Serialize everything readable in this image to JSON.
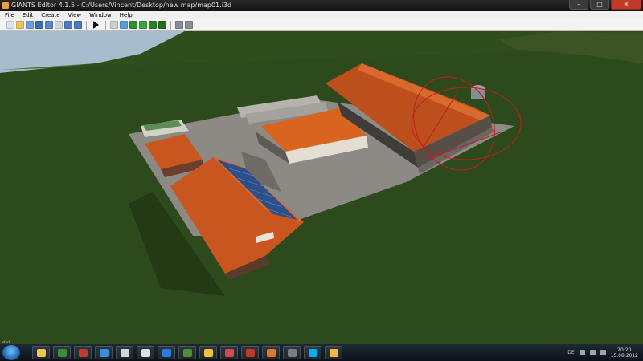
{
  "window": {
    "title": "GIANTS Editor 4.1.5 - C:/Users/Vincent/Desktop/new map/map01.i3d",
    "minimize": "–",
    "maximize": "□",
    "close": "✕"
  },
  "menu": [
    "File",
    "Edit",
    "Create",
    "View",
    "Window",
    "Help"
  ],
  "toolbar": {
    "icons": [
      {
        "name": "new-icon",
        "color": "#d9e3ef"
      },
      {
        "name": "open-icon",
        "color": "#e8c35a"
      },
      {
        "name": "import-icon",
        "color": "#6f9fd8"
      },
      {
        "name": "save-icon",
        "color": "#3b6fb5"
      },
      {
        "name": "save-as-icon",
        "color": "#5a88c6"
      },
      {
        "name": "reload-icon",
        "color": "#cfd6e0"
      },
      {
        "name": "undo-icon",
        "color": "#4b7ac0"
      },
      {
        "name": "redo-icon",
        "color": "#4b7ac0"
      },
      {
        "name": "sep"
      },
      {
        "name": "play-icon",
        "color": "#111111"
      },
      {
        "name": "sep"
      },
      {
        "name": "select-icon",
        "color": "#cfcfcf"
      },
      {
        "name": "move-icon",
        "color": "#5a9bd8"
      },
      {
        "name": "terrain-raise-icon",
        "color": "#2f8f2f"
      },
      {
        "name": "terrain-paint-icon",
        "color": "#3aa53a"
      },
      {
        "name": "terrain-smooth-icon",
        "color": "#2b7d2b"
      },
      {
        "name": "foliage-icon",
        "color": "#1f6f1f"
      },
      {
        "name": "sep"
      },
      {
        "name": "settings-icon",
        "color": "#8a8a9a"
      },
      {
        "name": "zoom-icon",
        "color": "#8a8a9a"
      }
    ]
  },
  "taskbar": {
    "start_label": "start",
    "apps": [
      {
        "name": "explorer-task",
        "color": "#f1c84b"
      },
      {
        "name": "tractor-task",
        "color": "#3f8b3a"
      },
      {
        "name": "game-task",
        "color": "#c0392b"
      },
      {
        "name": "ie-task",
        "color": "#3a8fd8"
      },
      {
        "name": "tool-task",
        "color": "#d6d6d6"
      },
      {
        "name": "cow-task",
        "color": "#e0e0e0"
      },
      {
        "name": "bluetooth-task",
        "color": "#2c7be5"
      },
      {
        "name": "minecraft-task",
        "color": "#4f8f32"
      },
      {
        "name": "globe-task",
        "color": "#f3c23d"
      },
      {
        "name": "draw-task",
        "color": "#d04b4b"
      },
      {
        "name": "k-task",
        "color": "#c0392b"
      },
      {
        "name": "firefox-task",
        "color": "#e8752b"
      },
      {
        "name": "drive-task",
        "color": "#7d7d7d"
      },
      {
        "name": "skype-task",
        "color": "#00aff0"
      },
      {
        "name": "giants-task",
        "color": "#f0b84a"
      }
    ],
    "language": "DE",
    "time": "20:20",
    "date": "15.08.2012"
  },
  "colors": {
    "grass": "#2e4a1c",
    "concrete": "#8d8a85",
    "roof": "#c9561f",
    "solar": "#2d4f8a"
  }
}
